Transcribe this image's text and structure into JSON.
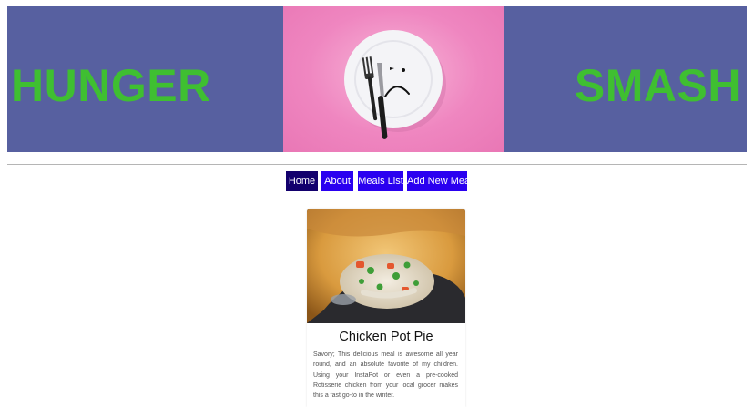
{
  "banner": {
    "left_text": "HUNGER",
    "right_text": "SMASH",
    "background": "#5760a0",
    "text_color": "#3fbf31"
  },
  "nav": {
    "items": [
      {
        "label": "Home",
        "active": true
      },
      {
        "label": "About",
        "active": false
      },
      {
        "label": "Meals List",
        "active": false
      },
      {
        "label": "Add New Meal",
        "active": false
      }
    ]
  },
  "meal": {
    "title": "Chicken Pot Pie",
    "description": "Savory; This delicious meal is awesome all year round, and an absolute favorite of my children. Using your InstaPot or even a pre-cooked Rotisserie chicken from your local grocer makes this a fast go-to in the winter."
  }
}
